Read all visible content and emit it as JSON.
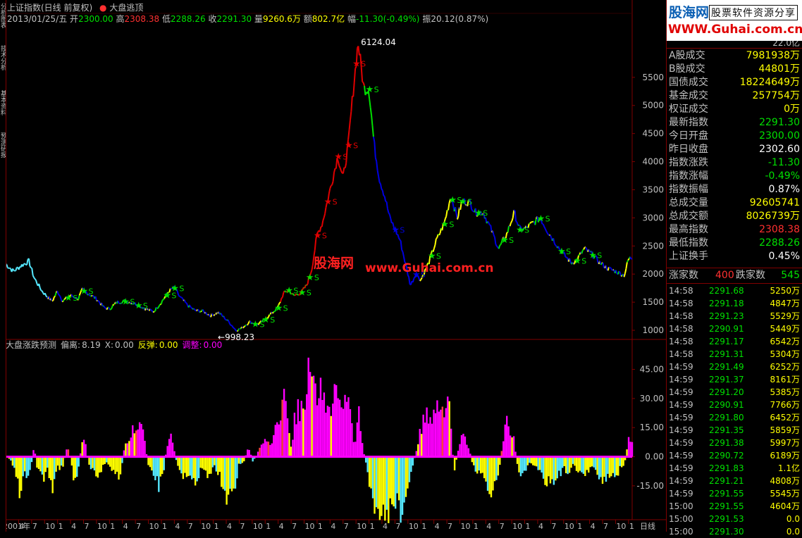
{
  "window": {
    "title": "上证指数(日线 前复权)",
    "indicator_title": "大盘逃顶",
    "left_tabs": [
      "分析图表",
      "技术分析",
      "基本资料",
      "预测研报"
    ]
  },
  "info_row": {
    "date": "2013/01/25/五",
    "open_label": "开",
    "open": "2300.00",
    "high_label": "高",
    "high": "2308.38",
    "low_label": "低",
    "low": "2288.26",
    "close_label": "收",
    "close": "2291.30",
    "volume_label": "量",
    "volume": "9260.6万",
    "amount_label": "额",
    "amount": "802.7亿",
    "change_label": "幅",
    "change": "-11.30(-0.49%)",
    "amplitude_label": "振",
    "amplitude": "20.12(0.87%)"
  },
  "watermark": {
    "cn": "股海网",
    "url": "www.Guhai.com.cn"
  },
  "sub_header": {
    "name": "大盘涨跌预测",
    "deviation_label": "偏离:",
    "deviation": "8.19",
    "x_label": "X:",
    "x": "0.00",
    "rebound_label": "反弹:",
    "rebound": "0.00",
    "adjust_label": "调整:",
    "adjust": "0.00"
  },
  "bottom_bar": {
    "period": "日线"
  },
  "right_panel": {
    "logo_line1": "股海网",
    "logo_line1b": "股票软件资源分享",
    "logo_line2": "WWW.Guhai.com.cn",
    "top_cut_value": "22.0亿",
    "stats": [
      {
        "label": "A股成交",
        "value": "7981938万",
        "color": "#ffff00"
      },
      {
        "label": "B股成交",
        "value": "44801万",
        "color": "#ffff00"
      },
      {
        "label": "国债成交",
        "value": "18224649万",
        "color": "#ffff00"
      },
      {
        "label": "基金成交",
        "value": "257754万",
        "color": "#ffff00"
      },
      {
        "label": "权证成交",
        "value": "0万",
        "color": "#ffff00"
      },
      {
        "label": "最新指数",
        "value": "2291.30",
        "color": "#00e000"
      },
      {
        "label": "今日开盘",
        "value": "2300.00",
        "color": "#00e000"
      },
      {
        "label": "昨日收盘",
        "value": "2302.60",
        "color": "#ffffff"
      },
      {
        "label": "指数涨跌",
        "value": "-11.30",
        "color": "#00e000"
      },
      {
        "label": "指数涨幅",
        "value": "-0.49%",
        "color": "#00e000"
      },
      {
        "label": "指数振幅",
        "value": "0.87%",
        "color": "#ffffff"
      },
      {
        "label": "总成交量",
        "value": "92605741",
        "color": "#ffff00"
      },
      {
        "label": "总成交额",
        "value": "8026739万",
        "color": "#ffff00"
      },
      {
        "label": "最高指数",
        "value": "2308.38",
        "color": "#ff3030"
      },
      {
        "label": "最低指数",
        "value": "2288.26",
        "color": "#00e000"
      },
      {
        "label": "上证换手",
        "value": "0.45%",
        "color": "#ffffff"
      }
    ],
    "breadth": {
      "up_label": "涨家数",
      "up": "400",
      "down_label": "跌家数",
      "down": "545"
    },
    "ticks": [
      {
        "time": "14:58",
        "price": "2291.68",
        "vol": "5250万"
      },
      {
        "time": "14:58",
        "price": "2291.18",
        "vol": "4847万"
      },
      {
        "time": "14:58",
        "price": "2291.23",
        "vol": "5529万"
      },
      {
        "time": "14:58",
        "price": "2290.91",
        "vol": "5449万"
      },
      {
        "time": "14:58",
        "price": "2291.17",
        "vol": "6542万"
      },
      {
        "time": "14:58",
        "price": "2291.31",
        "vol": "5304万"
      },
      {
        "time": "14:59",
        "price": "2291.49",
        "vol": "6252万"
      },
      {
        "time": "14:59",
        "price": "2291.37",
        "vol": "8161万"
      },
      {
        "time": "14:59",
        "price": "2291.20",
        "vol": "5385万"
      },
      {
        "time": "14:59",
        "price": "2290.91",
        "vol": "7766万"
      },
      {
        "time": "14:59",
        "price": "2291.80",
        "vol": "6452万"
      },
      {
        "time": "14:59",
        "price": "2291.35",
        "vol": "5859万"
      },
      {
        "time": "14:59",
        "price": "2291.38",
        "vol": "5997万"
      },
      {
        "time": "14:59",
        "price": "2290.72",
        "vol": "6189万"
      },
      {
        "time": "14:59",
        "price": "2291.83",
        "vol": "1.1亿"
      },
      {
        "time": "14:59",
        "price": "2291.21",
        "vol": "4808万"
      },
      {
        "time": "14:59",
        "price": "2291.55",
        "vol": "5545万"
      },
      {
        "time": "15:00",
        "price": "2291.55",
        "vol": "4604万"
      },
      {
        "time": "15:00",
        "price": "2291.53",
        "vol": "0.0"
      },
      {
        "time": "15:00",
        "price": "2291.30",
        "vol": "0.0"
      }
    ]
  },
  "colors": {
    "up": "#ff3030",
    "down": "#00e000",
    "neutral": "#ffffff",
    "volume": "#ffff00",
    "label": "#c0c0c0",
    "frame": "#800000",
    "magenta": "#ff00ff",
    "cyan": "#55e8ff",
    "yellow": "#ffff00",
    "blue": "#0000e0",
    "green": "#00e000",
    "red": "#e00000"
  },
  "chart_data": [
    {
      "type": "line",
      "title": "上证指数(日线 前复权)",
      "ylim": [
        850,
        6400
      ],
      "yticks": [
        1000,
        1500,
        2000,
        2500,
        3000,
        3500,
        4000,
        4500,
        5000,
        5500
      ],
      "x_labels": [
        "2001年",
        "4",
        "7",
        "10",
        "1",
        "4",
        "7",
        "10",
        "1",
        "4",
        "7",
        "10",
        "1",
        "4",
        "7",
        "10",
        "1",
        "4",
        "7",
        "10",
        "1",
        "4",
        "7",
        "10",
        "1",
        "4",
        "7",
        "10",
        "1",
        "4",
        "7",
        "10",
        "1",
        "4",
        "7",
        "10",
        "1",
        "4",
        "7",
        "10",
        "1",
        "4",
        "7",
        "10",
        "1",
        "4",
        "7",
        "10",
        "1"
      ],
      "annotations": [
        {
          "text": "6124.04",
          "x": 2007.79,
          "y": 6124.04
        },
        {
          "text": "998.23",
          "x": 2005.44,
          "y": 998.23
        }
      ],
      "series_points": [
        [
          2001.0,
          2180
        ],
        [
          2001.15,
          2050
        ],
        [
          2001.3,
          2150
        ],
        [
          2001.45,
          2230
        ],
        [
          2001.55,
          1930
        ],
        [
          2001.7,
          1700
        ],
        [
          2001.8,
          1600
        ],
        [
          2001.9,
          1520
        ],
        [
          2002.0,
          1700
        ],
        [
          2002.1,
          1520
        ],
        [
          2002.25,
          1620
        ],
        [
          2002.4,
          1560
        ],
        [
          2002.48,
          1720
        ],
        [
          2002.6,
          1650
        ],
        [
          2002.75,
          1560
        ],
        [
          2002.9,
          1400
        ],
        [
          2003.0,
          1380
        ],
        [
          2003.15,
          1500
        ],
        [
          2003.3,
          1520
        ],
        [
          2003.45,
          1490
        ],
        [
          2003.55,
          1450
        ],
        [
          2003.7,
          1380
        ],
        [
          2003.85,
          1330
        ],
        [
          2004.0,
          1500
        ],
        [
          2004.15,
          1700
        ],
        [
          2004.25,
          1760
        ],
        [
          2004.35,
          1600
        ],
        [
          2004.5,
          1450
        ],
        [
          2004.65,
          1350
        ],
        [
          2004.8,
          1340
        ],
        [
          2004.95,
          1260
        ],
        [
          2005.1,
          1320
        ],
        [
          2005.3,
          1150
        ],
        [
          2005.44,
          998
        ],
        [
          2005.55,
          1040
        ],
        [
          2005.7,
          1150
        ],
        [
          2005.85,
          1100
        ],
        [
          2005.95,
          1160
        ],
        [
          2006.1,
          1280
        ],
        [
          2006.25,
          1410
        ],
        [
          2006.35,
          1650
        ],
        [
          2006.45,
          1720
        ],
        [
          2006.55,
          1610
        ],
        [
          2006.7,
          1680
        ],
        [
          2006.8,
          1800
        ],
        [
          2006.9,
          2100
        ],
        [
          2007.0,
          2700
        ],
        [
          2007.1,
          2900
        ],
        [
          2007.2,
          3300
        ],
        [
          2007.3,
          3700
        ],
        [
          2007.4,
          4100
        ],
        [
          2007.5,
          3700
        ],
        [
          2007.6,
          4300
        ],
        [
          2007.7,
          5300
        ],
        [
          2007.79,
          6124
        ],
        [
          2007.9,
          5300
        ],
        [
          2008.0,
          5300
        ],
        [
          2008.1,
          4300
        ],
        [
          2008.2,
          3700
        ],
        [
          2008.3,
          3400
        ],
        [
          2008.4,
          3000
        ],
        [
          2008.5,
          2800
        ],
        [
          2008.6,
          2600
        ],
        [
          2008.7,
          2200
        ],
        [
          2008.8,
          1800
        ],
        [
          2008.9,
          2000
        ],
        [
          2009.0,
          1900
        ],
        [
          2009.15,
          2200
        ],
        [
          2009.3,
          2600
        ],
        [
          2009.45,
          2900
        ],
        [
          2009.58,
          3400
        ],
        [
          2009.7,
          3000
        ],
        [
          2009.8,
          3300
        ],
        [
          2009.95,
          3270
        ],
        [
          2010.05,
          3100
        ],
        [
          2010.2,
          3100
        ],
        [
          2010.35,
          2800
        ],
        [
          2010.5,
          2450
        ],
        [
          2010.65,
          2700
        ],
        [
          2010.8,
          3100
        ],
        [
          2010.9,
          2800
        ],
        [
          2011.0,
          2800
        ],
        [
          2011.15,
          2900
        ],
        [
          2011.3,
          3000
        ],
        [
          2011.45,
          2750
        ],
        [
          2011.6,
          2550
        ],
        [
          2011.75,
          2350
        ],
        [
          2011.9,
          2200
        ],
        [
          2012.0,
          2250
        ],
        [
          2012.15,
          2450
        ],
        [
          2012.3,
          2350
        ],
        [
          2012.45,
          2200
        ],
        [
          2012.6,
          2100
        ],
        [
          2012.75,
          2050
        ],
        [
          2012.92,
          1980
        ],
        [
          2013.0,
          2270
        ],
        [
          2013.07,
          2291
        ]
      ]
    },
    {
      "type": "bar",
      "title": "大盘涨跌预测",
      "ylim": [
        -31,
        55
      ],
      "yticks": [
        -15,
        0,
        15,
        30,
        45
      ],
      "series": [
        {
          "name": "偏离",
          "values_key": "deviation",
          "note": "magenta positive / yellow-cyan negative"
        }
      ],
      "deviation_points": [
        [
          2001.0,
          0
        ],
        [
          2001.05,
          0
        ],
        [
          2001.2,
          -8
        ],
        [
          2001.28,
          -20
        ],
        [
          2001.35,
          -5
        ],
        [
          2001.45,
          -12
        ],
        [
          2001.55,
          5
        ],
        [
          2001.62,
          -8
        ],
        [
          2001.72,
          -12
        ],
        [
          2001.8,
          -4
        ],
        [
          2001.9,
          -18
        ],
        [
          2002.0,
          -6
        ],
        [
          2002.1,
          -5
        ],
        [
          2002.2,
          6
        ],
        [
          2002.3,
          -10
        ],
        [
          2002.4,
          -8
        ],
        [
          2002.48,
          10
        ],
        [
          2002.55,
          5
        ],
        [
          2002.6,
          -5
        ],
        [
          2002.7,
          -8
        ],
        [
          2002.8,
          -10
        ],
        [
          2002.9,
          -3
        ],
        [
          2003.0,
          -4
        ],
        [
          2003.1,
          -9
        ],
        [
          2003.2,
          -10
        ],
        [
          2003.3,
          6
        ],
        [
          2003.4,
          10
        ],
        [
          2003.5,
          16
        ],
        [
          2003.6,
          18
        ],
        [
          2003.68,
          8
        ],
        [
          2003.75,
          -5
        ],
        [
          2003.85,
          -8
        ],
        [
          2003.95,
          -15
        ],
        [
          2004.05,
          -6
        ],
        [
          2004.12,
          8
        ],
        [
          2004.2,
          10
        ],
        [
          2004.3,
          -4
        ],
        [
          2004.4,
          -12
        ],
        [
          2004.5,
          -8
        ],
        [
          2004.6,
          -14
        ],
        [
          2004.7,
          -10
        ],
        [
          2004.8,
          -6
        ],
        [
          2004.9,
          -12
        ],
        [
          2005.0,
          -4
        ],
        [
          2005.1,
          -8
        ],
        [
          2005.18,
          -14
        ],
        [
          2005.26,
          -22
        ],
        [
          2005.32,
          -14
        ],
        [
          2005.4,
          -16
        ],
        [
          2005.5,
          -4
        ],
        [
          2005.6,
          -2
        ],
        [
          2005.68,
          6
        ],
        [
          2005.76,
          -2
        ],
        [
          2005.82,
          0
        ],
        [
          2005.9,
          4
        ],
        [
          2006.0,
          12
        ],
        [
          2006.1,
          8
        ],
        [
          2006.18,
          12
        ],
        [
          2006.26,
          18
        ],
        [
          2006.34,
          32
        ],
        [
          2006.42,
          24
        ],
        [
          2006.5,
          5
        ],
        [
          2006.58,
          22
        ],
        [
          2006.66,
          25
        ],
        [
          2006.74,
          28
        ],
        [
          2006.82,
          40
        ],
        [
          2006.9,
          50
        ],
        [
          2006.96,
          36
        ],
        [
          2007.05,
          30
        ],
        [
          2007.12,
          38
        ],
        [
          2007.2,
          24
        ],
        [
          2007.28,
          26
        ],
        [
          2007.36,
          35
        ],
        [
          2007.45,
          28
        ],
        [
          2007.54,
          25
        ],
        [
          2007.62,
          30
        ],
        [
          2007.72,
          5
        ],
        [
          2007.8,
          25
        ],
        [
          2007.88,
          5
        ],
        [
          2007.96,
          -5
        ],
        [
          2008.05,
          -20
        ],
        [
          2008.15,
          -28
        ],
        [
          2008.25,
          -25
        ],
        [
          2008.35,
          -30
        ],
        [
          2008.45,
          -24
        ],
        [
          2008.55,
          -26
        ],
        [
          2008.65,
          -30
        ],
        [
          2008.75,
          -14
        ],
        [
          2008.85,
          -5
        ],
        [
          2008.92,
          5
        ],
        [
          2009.0,
          15
        ],
        [
          2009.1,
          20
        ],
        [
          2009.2,
          22
        ],
        [
          2009.3,
          24
        ],
        [
          2009.4,
          22
        ],
        [
          2009.5,
          28
        ],
        [
          2009.56,
          24
        ],
        [
          2009.64,
          -8
        ],
        [
          2009.72,
          4
        ],
        [
          2009.8,
          10
        ],
        [
          2009.9,
          8
        ],
        [
          2010.0,
          -4
        ],
        [
          2010.1,
          -8
        ],
        [
          2010.2,
          -10
        ],
        [
          2010.3,
          -15
        ],
        [
          2010.4,
          -18
        ],
        [
          2010.5,
          -8
        ],
        [
          2010.58,
          8
        ],
        [
          2010.66,
          18
        ],
        [
          2010.72,
          14
        ],
        [
          2010.8,
          8
        ],
        [
          2010.88,
          -10
        ],
        [
          2010.96,
          -8
        ],
        [
          2011.05,
          -5
        ],
        [
          2011.15,
          -3
        ],
        [
          2011.25,
          -8
        ],
        [
          2011.35,
          -10
        ],
        [
          2011.45,
          -14
        ],
        [
          2011.55,
          -12
        ],
        [
          2011.65,
          -10
        ],
        [
          2011.75,
          -6
        ],
        [
          2011.85,
          -8
        ],
        [
          2011.95,
          -4
        ],
        [
          2012.05,
          -8
        ],
        [
          2012.15,
          -10
        ],
        [
          2012.25,
          -7
        ],
        [
          2012.35,
          -6
        ],
        [
          2012.45,
          -10
        ],
        [
          2012.55,
          -12
        ],
        [
          2012.65,
          -8
        ],
        [
          2012.75,
          -10
        ],
        [
          2012.85,
          -6
        ],
        [
          2012.92,
          -4
        ],
        [
          2013.0,
          8
        ],
        [
          2013.07,
          10
        ]
      ]
    }
  ]
}
